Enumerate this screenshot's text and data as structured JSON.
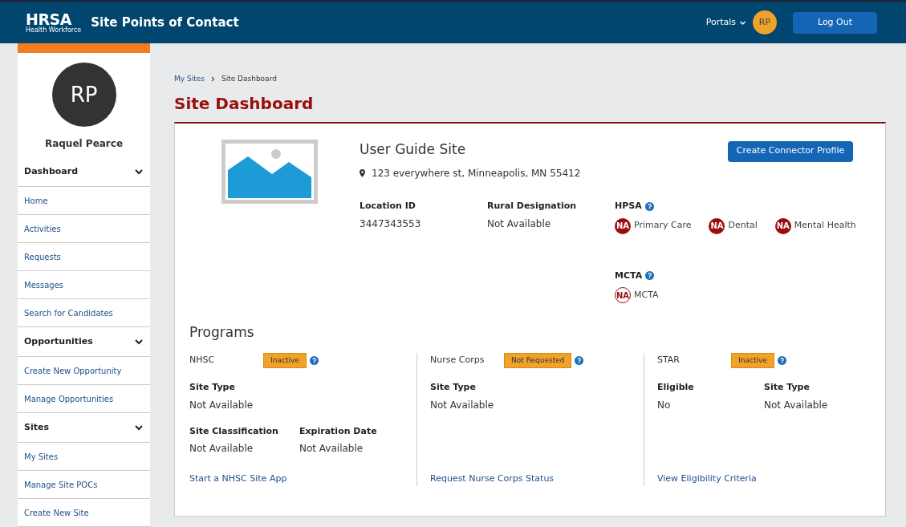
{
  "header": {
    "logo_title": "HRSA",
    "logo_subtitle": "Health Workforce",
    "app_title": "Site Points of Contact",
    "portals": "Portals",
    "avatar": "RP",
    "logout": "Log Out"
  },
  "sidebar": {
    "avatar": "RP",
    "user_name": "Raquel Pearce",
    "sections": [
      {
        "title": "Dashboard",
        "expanded": true,
        "items": [
          "Home",
          "Activities",
          "Requests",
          "Messages",
          "Search for Candidates"
        ]
      },
      {
        "title": "Opportunities",
        "expanded": true,
        "items": [
          "Create New Opportunity",
          "Manage Opportunities"
        ]
      },
      {
        "title": "Sites",
        "expanded": true,
        "items": [
          "My Sites",
          "Manage Site POCs",
          "Create New Site"
        ]
      }
    ]
  },
  "breadcrumb": [
    "My Sites",
    "Site Dashboard"
  ],
  "page_title": "Site Dashboard",
  "site": {
    "name": "User Guide Site",
    "address": "123 everywhere st, Minneapolis, MN 55412",
    "button": "Create Connector Profile",
    "fields": [
      {
        "label": "Location ID",
        "value": "3447343553"
      },
      {
        "label": "Rural Designation",
        "value": "Not Available"
      }
    ],
    "hpsa": {
      "title": "HPSA",
      "items": [
        {
          "badge": "NA",
          "label": "Primary Care",
          "kind": "filled"
        },
        {
          "badge": "NA",
          "label": "Dental",
          "kind": "filled"
        },
        {
          "badge": "NA",
          "label": "Mental Health",
          "kind": "filled"
        }
      ]
    },
    "mcta": {
      "title": "MCTA",
      "items": [
        {
          "badge": "NA",
          "label": "MCTA",
          "kind": "outline"
        }
      ]
    }
  },
  "programs": {
    "title": "Programs",
    "columns": [
      {
        "name": "NHSC",
        "status": "Inactive",
        "rows": [
          [
            {
              "label": "Site Type",
              "value": "Not Available"
            }
          ],
          [
            {
              "label": "Site Classification",
              "value": "Not Available"
            },
            {
              "label": "Expiration Date",
              "value": "Not Available"
            }
          ]
        ],
        "link": "Start a NHSC Site App"
      },
      {
        "name": "Nurse Corps",
        "status": "Not Requested",
        "rows": [
          [
            {
              "label": "Site Type",
              "value": "Not Available"
            }
          ]
        ],
        "link": "Request Nurse Corps Status"
      },
      {
        "name": "STAR",
        "status": "Inactive",
        "rows": [
          [
            {
              "label": "Eligible",
              "value": "No"
            },
            {
              "label": "Site Type",
              "value": "Not Available"
            }
          ]
        ],
        "link": "View Eligibility Criteria"
      }
    ]
  }
}
